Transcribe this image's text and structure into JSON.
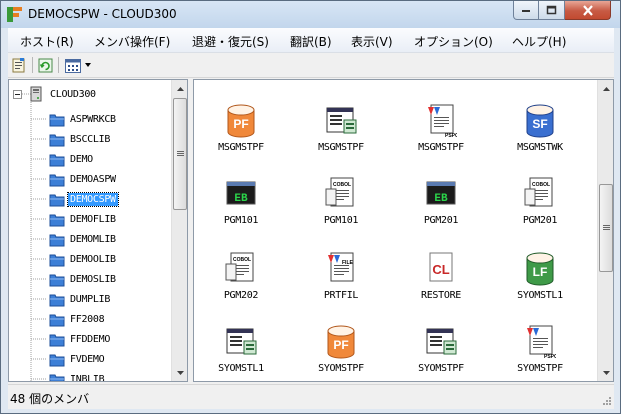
{
  "window": {
    "title": "DEMOCSPW - CLOUD300"
  },
  "menubar": {
    "items": [
      "ホスト(R)",
      "メンバ操作(F)",
      "退避・復元(S)",
      "翻訳(B)",
      "表示(V)",
      "オプション(O)",
      "ヘルプ(H)"
    ]
  },
  "toolbar": {
    "icons": [
      "properties-icon",
      "refresh-icon",
      "view-mode-icon",
      "dropdown-arrow-icon"
    ]
  },
  "tree": {
    "root": "CLOUD300",
    "items": [
      "ASPWRKCB",
      "BSCCLIB",
      "DEMO",
      "DEMOASPW",
      "DEMOCSPW",
      "DEMOFLIB",
      "DEMOMLIB",
      "DEMOOLIB",
      "DEMOSLIB",
      "DUMPLIB",
      "FF2008",
      "FFDDEMO",
      "FVDEMO",
      "INBLIB"
    ],
    "selected": "DEMOCSPW"
  },
  "members": [
    {
      "name": "MSGMSTPF",
      "type": "pf"
    },
    {
      "name": "MSGMSTPF",
      "type": "window"
    },
    {
      "name": "MSGMSTPF",
      "type": "pspc"
    },
    {
      "name": "MSGMSTWK",
      "type": "sf"
    },
    {
      "name": "PGM101",
      "type": "eb"
    },
    {
      "name": "PGM101",
      "type": "cobol"
    },
    {
      "name": "PGM201",
      "type": "eb"
    },
    {
      "name": "PGM201",
      "type": "cobol"
    },
    {
      "name": "PGM202",
      "type": "cobol"
    },
    {
      "name": "PRTFIL",
      "type": "file"
    },
    {
      "name": "RESTORE",
      "type": "cl"
    },
    {
      "name": "SYOMSTL1",
      "type": "lf"
    },
    {
      "name": "SYOMSTL1",
      "type": "window"
    },
    {
      "name": "SYOMSTPF",
      "type": "pf"
    },
    {
      "name": "SYOMSTPF",
      "type": "window"
    },
    {
      "name": "SYOMSTPF",
      "type": "pspc"
    }
  ],
  "status": {
    "text": "48 個のメンバ"
  },
  "icon_badges": {
    "pf": "PF",
    "sf": "SF",
    "lf": "LF",
    "eb": "EB",
    "cl": "CL",
    "cobol": "COBOL",
    "pspc": "PSPC",
    "file": "FILE"
  },
  "colors": {
    "accent": "#3399ff",
    "pf": "#f0883a",
    "sf": "#3a6fd0",
    "lf": "#3f9a48",
    "eb": "#2bd34a",
    "cl": "#c82828"
  }
}
